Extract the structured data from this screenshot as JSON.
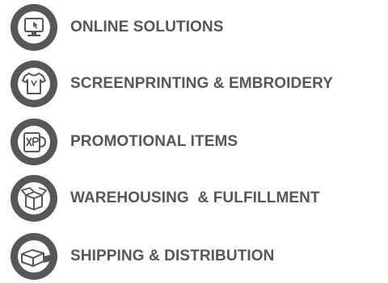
{
  "services": [
    {
      "label": "ONLINE SOLUTIONS",
      "icon": "computer-monitor-icon"
    },
    {
      "label": "SCREENPRINTING & EMBROIDERY",
      "icon": "t-shirt-icon"
    },
    {
      "label": "PROMOTIONAL ITEMS",
      "icon": "mug-icon"
    },
    {
      "label": "WAREHOUSING  & FULFILLMENT",
      "icon": "box-icon"
    },
    {
      "label": "SHIPPING & DISTRIBUTION",
      "icon": "shipping-box-icon"
    }
  ],
  "colors": {
    "icon_ring": "#55575a",
    "icon_inner": "#ffffff",
    "icon_glyph": "#55575a",
    "text": "#55575a"
  }
}
